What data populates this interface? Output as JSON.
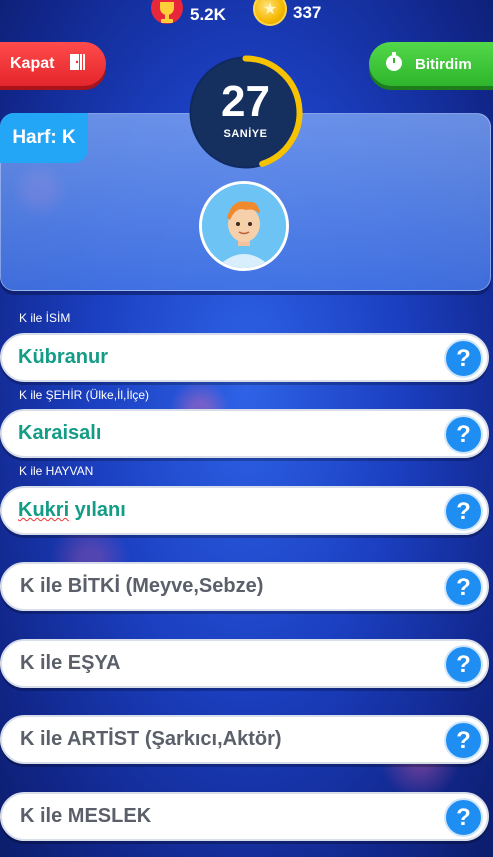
{
  "stats": {
    "trophies": "5.2K",
    "coins": "337"
  },
  "buttons": {
    "close": "Kapat",
    "finish": "Bitirdim"
  },
  "timer": {
    "seconds": "27",
    "unit": "SANİYE",
    "remaining_fraction": 0.45
  },
  "letter_tag": "Harf: K",
  "colors": {
    "accent_blue": "#1e8ef2",
    "answer_green": "#139c86",
    "close_red": "#e3262b",
    "finish_green": "#2eb52b",
    "timer_arc": "#f7c300"
  },
  "fields": [
    {
      "label": "K ile İSİM",
      "value": "Kübranur",
      "placeholder": ""
    },
    {
      "label": "K ile ŞEHİR (Ülke,İl,İlçe)",
      "value": "Karaisalı",
      "placeholder": ""
    },
    {
      "label": "K ile HAYVAN",
      "value_part1": "Kukri",
      "value_part2": " yılanı",
      "placeholder": ""
    },
    {
      "label": "",
      "value": "",
      "placeholder": "K ile BİTKİ (Meyve,Sebze)"
    },
    {
      "label": "",
      "value": "",
      "placeholder": "K ile EŞYA"
    },
    {
      "label": "",
      "value": "",
      "placeholder": "K ile ARTİST (Şarkıcı,Aktör)"
    },
    {
      "label": "",
      "value": "",
      "placeholder": "K ile MESLEK"
    }
  ],
  "help_symbol": "?"
}
